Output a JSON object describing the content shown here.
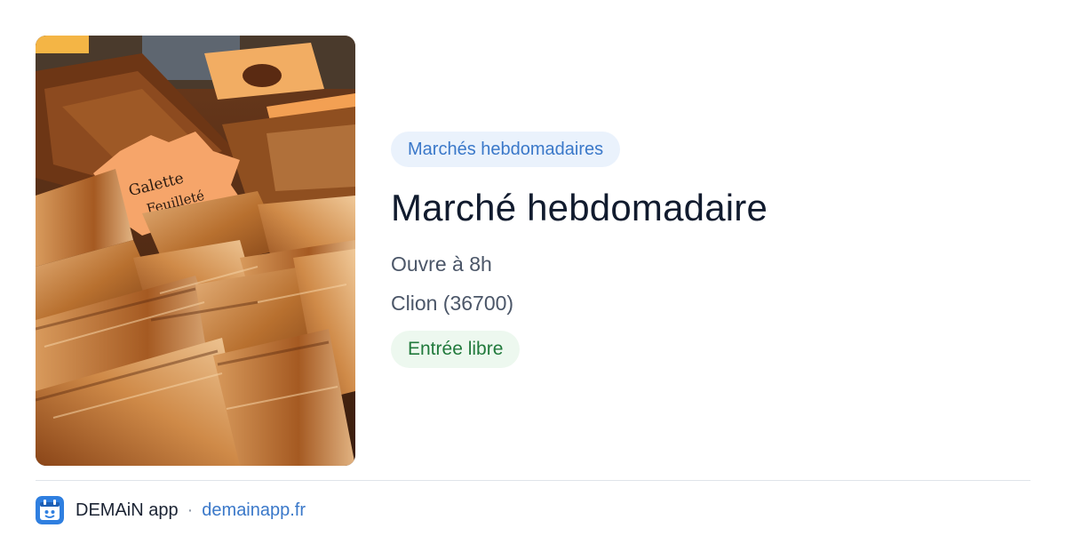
{
  "event": {
    "category": "Marchés hebdomadaires",
    "title": "Marché hebdomadaire",
    "hours": "Ouvre à 8h",
    "location": "Clion (36700)",
    "entry": "Entrée libre"
  },
  "photo": {
    "subject": "pastries at market stall",
    "sign_text": "Galette Feuilleté Loire"
  },
  "footer": {
    "app_icon": "demain-app-icon",
    "app_name": "DEMAiN app",
    "separator": "·",
    "domain": "demainapp.fr"
  },
  "colors": {
    "category_bg": "#eaf2fc",
    "category_text": "#3a78c9",
    "title_text": "#111b2e",
    "body_text": "#4b5668",
    "entry_bg": "#edf8ef",
    "entry_text": "#217a3c",
    "link": "#3a78c9",
    "app_icon_blue": "#2f7fe0"
  }
}
